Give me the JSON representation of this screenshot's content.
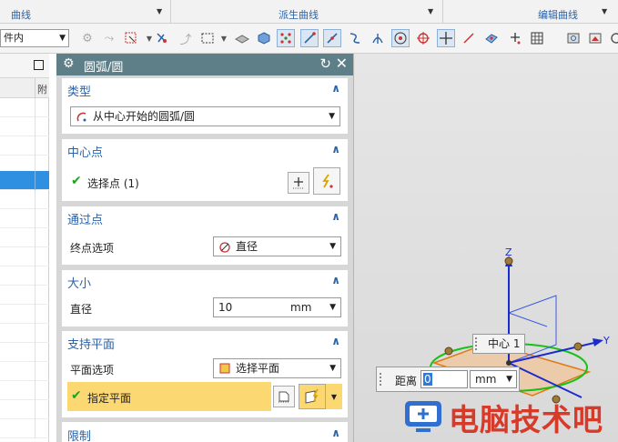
{
  "ribbon": {
    "groups": [
      {
        "label": "曲线"
      },
      {
        "label": "派生曲线"
      },
      {
        "label": "编辑曲线"
      }
    ]
  },
  "toolbar": {
    "filter_value": "件内"
  },
  "navigator": {
    "column_header": "附"
  },
  "dialog": {
    "title": "圆弧/圆",
    "sections": {
      "type": {
        "header": "类型",
        "value": "从中心开始的圆弧/圆"
      },
      "center": {
        "header": "中心点",
        "select_point": "选择点 (1)"
      },
      "through": {
        "header": "通过点",
        "endpoint_label": "终点选项",
        "endpoint_value": "直径"
      },
      "size": {
        "header": "大小",
        "diameter_label": "直径",
        "diameter_value": "10",
        "unit": "mm"
      },
      "support_plane": {
        "header": "支持平面",
        "plane_option_label": "平面选项",
        "plane_option_value": "选择平面",
        "specify_plane": "指定平面"
      },
      "limits": {
        "header": "限制"
      }
    }
  },
  "viewport": {
    "axis_z": "Z",
    "axis_y": "Y",
    "center_tip": "中心 1",
    "distance_label": "距离",
    "distance_value": "0",
    "distance_unit": "mm"
  },
  "watermark": {
    "text": "电脑技术吧"
  },
  "colors": {
    "accent_blue": "#2b63a8",
    "title_bar": "#5f7f88",
    "highlight_row": "#fbd872",
    "selection_blue": "#2f8fe0",
    "watermark_red": "#d83a2a"
  }
}
